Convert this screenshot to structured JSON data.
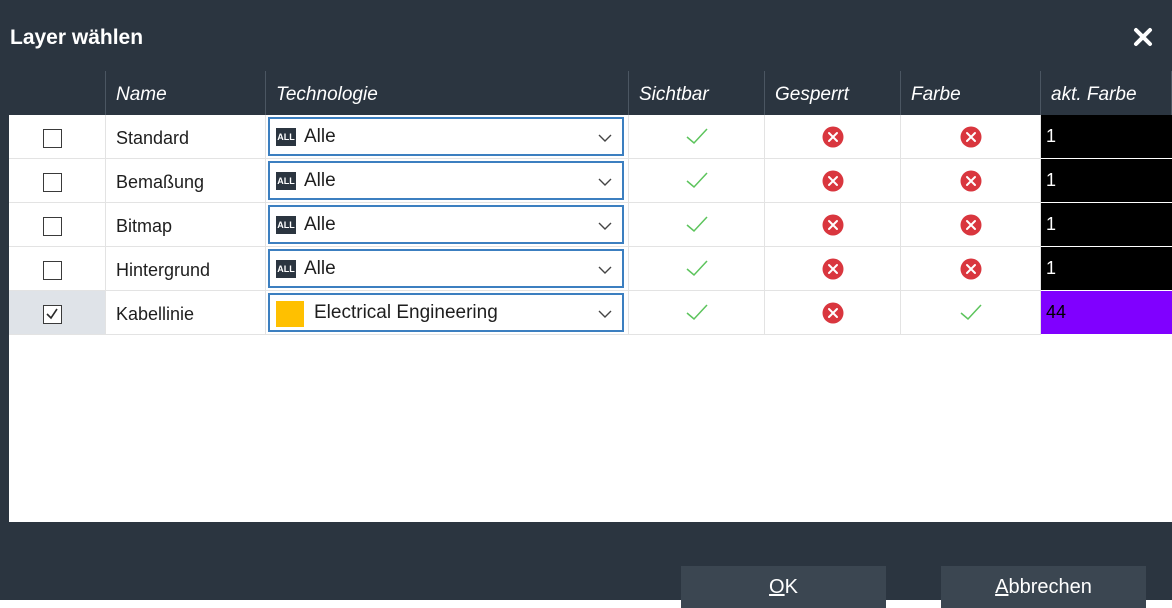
{
  "dialog": {
    "title": "Layer wählen",
    "ok_label_mnemonic": "O",
    "ok_label_rest": "K",
    "cancel_label_mnemonic": "A",
    "cancel_label_rest": "bbrechen"
  },
  "table": {
    "headers": [
      "",
      "Name",
      "Technologie",
      "Sichtbar",
      "Gesperrt",
      "Farbe",
      "akt. Farbe"
    ],
    "rows": [
      {
        "checked": false,
        "name": "Standard",
        "tech_icon": "all-badge",
        "tech_badge_text": "ALL",
        "technology": "Alle",
        "visible": true,
        "locked": false,
        "color": false,
        "current_color": "1",
        "current_color_hex": "#000000",
        "current_color_text_hex": "#ffffff"
      },
      {
        "checked": false,
        "name": "Bemaßung",
        "tech_icon": "all-badge",
        "tech_badge_text": "ALL",
        "technology": "Alle",
        "visible": true,
        "locked": false,
        "color": false,
        "current_color": "1",
        "current_color_hex": "#000000",
        "current_color_text_hex": "#ffffff"
      },
      {
        "checked": false,
        "name": "Bitmap",
        "tech_icon": "all-badge",
        "tech_badge_text": "ALL",
        "technology": "Alle",
        "visible": true,
        "locked": false,
        "color": false,
        "current_color": "1",
        "current_color_hex": "#000000",
        "current_color_text_hex": "#ffffff"
      },
      {
        "checked": false,
        "name": "Hintergrund",
        "tech_icon": "all-badge",
        "tech_badge_text": "ALL",
        "technology": "Alle",
        "visible": true,
        "locked": false,
        "color": false,
        "current_color": "1",
        "current_color_hex": "#000000",
        "current_color_text_hex": "#ffffff"
      },
      {
        "checked": true,
        "name": "Kabellinie",
        "tech_icon": "yellow-swatch",
        "tech_badge_text": "",
        "technology": "Electrical Engineering",
        "tech_swatch_hex": "#ffc000",
        "visible": true,
        "locked": false,
        "color": true,
        "current_color": "44",
        "current_color_hex": "#8000ff",
        "current_color_text_hex": "#000000"
      }
    ]
  },
  "colors": {
    "chrome": "#2b3540",
    "selected_row": "#dfe3e8",
    "check_green": "#5cc45c",
    "x_red": "#d9363e",
    "combo_border": "#3c7fc0"
  }
}
